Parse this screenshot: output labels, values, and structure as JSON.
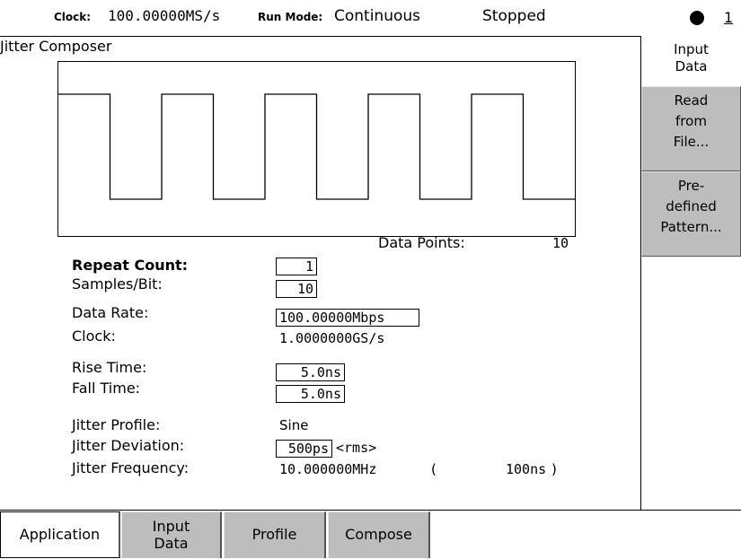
{
  "status_bar": {
    "clock_label": "Clock:",
    "clock_value": "100.00000MS/s",
    "run_mode_label": "Run Mode:",
    "run_mode_value": "Continuous",
    "state": "Stopped",
    "page_indicator": "1"
  },
  "composer": {
    "title": "Jitter Composer",
    "data_points_label": "Data Points:",
    "data_points_value": "10",
    "waveform_bits": [
      1,
      0,
      1,
      0,
      1,
      0,
      1,
      0,
      1,
      0
    ]
  },
  "params": {
    "repeat_count_label": "Repeat Count:",
    "repeat_count_value": "1",
    "samples_per_bit_label": "Samples/Bit:",
    "samples_per_bit_value": "10",
    "data_rate_label": "Data Rate:",
    "data_rate_value": "100.00000Mbps",
    "clock_label": "Clock:",
    "clock_value": "1.0000000GS/s",
    "rise_time_label": "Rise Time:",
    "rise_time_value": "5.0ns",
    "fall_time_label": "Fall Time:",
    "fall_time_value": "5.0ns",
    "jitter_profile_label": "Jitter Profile:",
    "jitter_profile_value": "Sine",
    "jitter_deviation_label": "Jitter Deviation:",
    "jitter_deviation_value": "500ps",
    "jitter_deviation_unit": "<rms>",
    "jitter_frequency_label": "Jitter Frequency:",
    "jitter_frequency_value": "10.000000MHz",
    "jitter_period_open": "(",
    "jitter_period_value": "100ns",
    "jitter_period_close": ")"
  },
  "side_menu": {
    "header_line1": "Input",
    "header_line2": "Data",
    "read_file_line1": "Read",
    "read_file_line2": "from",
    "read_file_line3": "File...",
    "predefined_line1": "Pre-",
    "predefined_line2": "defined",
    "predefined_line3": "Pattern..."
  },
  "bottom_tabs": {
    "application": "Application",
    "input_data_line1": "Input",
    "input_data_line2": "Data",
    "profile": "Profile",
    "compose": "Compose"
  },
  "colors": {
    "button_gray": "#bdbdbd",
    "background": "#ffffff",
    "foreground": "#000000"
  }
}
